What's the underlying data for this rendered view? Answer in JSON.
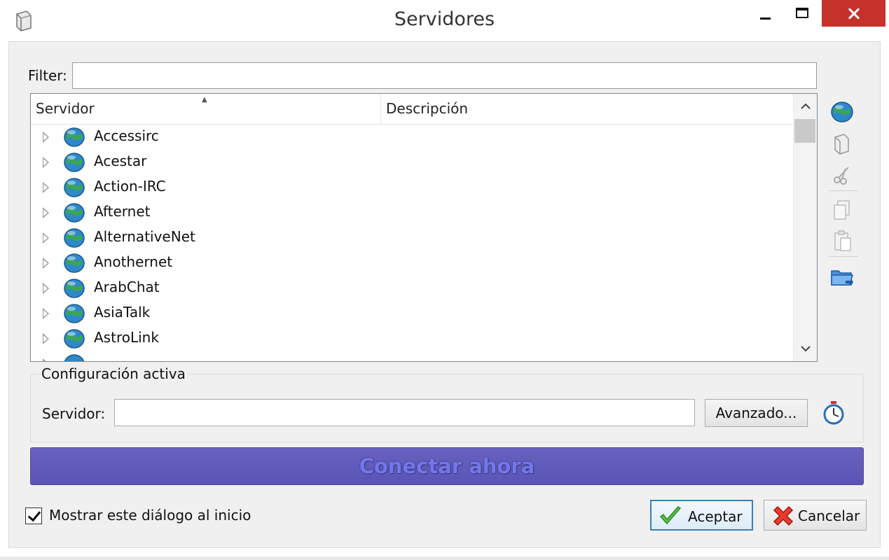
{
  "window": {
    "title": "Servidores",
    "icon": "server-icon"
  },
  "filter": {
    "label": "Filter:",
    "value": ""
  },
  "server_list": {
    "columns": [
      "Servidor",
      "Descripción"
    ],
    "sorted_column": "Servidor",
    "rows": [
      {
        "name": "Accessirc",
        "description": ""
      },
      {
        "name": "Acestar",
        "description": ""
      },
      {
        "name": "Action-IRC",
        "description": ""
      },
      {
        "name": "Afternet",
        "description": ""
      },
      {
        "name": "AlternativeNet",
        "description": ""
      },
      {
        "name": "Anothernet",
        "description": ""
      },
      {
        "name": "ArabChat",
        "description": ""
      },
      {
        "name": "AsiaTalk",
        "description": ""
      },
      {
        "name": "AstroLink",
        "description": ""
      }
    ]
  },
  "side_toolbar": [
    "add-network-icon",
    "add-server-icon",
    "cut-icon",
    "copy-icon",
    "paste-icon",
    "import-folder-icon"
  ],
  "active_config": {
    "legend": "Configuración activa",
    "server_label": "Servidor:",
    "server_value": "",
    "advanced_label": "Avanzado..."
  },
  "connect_label": "Conectar ahora",
  "footer": {
    "show_dialog_label": "Mostrar este diálogo al inicio",
    "show_dialog_checked": true,
    "ok_label": "Aceptar",
    "cancel_label": "Cancelar"
  },
  "colors": {
    "connect_bar": "#5e59b8",
    "close_button": "#c7312b",
    "ok_border": "#3c7fb1"
  }
}
